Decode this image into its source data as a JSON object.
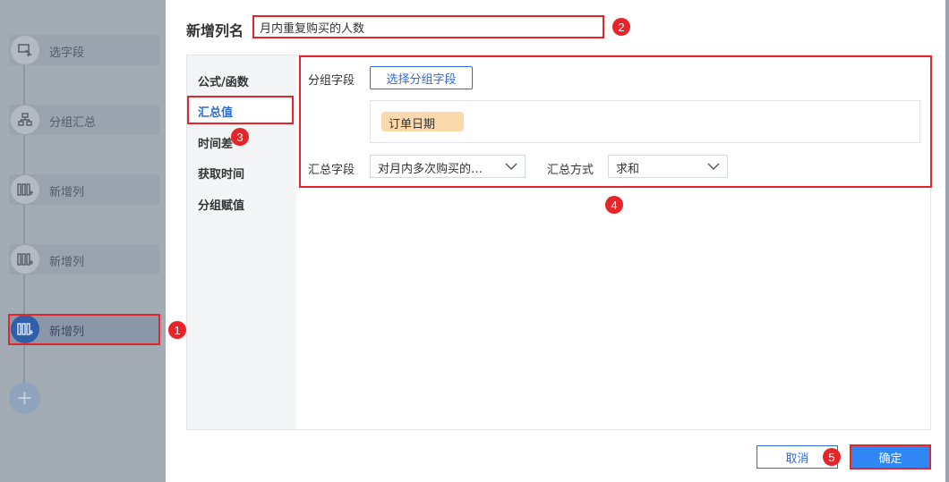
{
  "steps": [
    {
      "label": "选字段",
      "icon": "select-field-icon"
    },
    {
      "label": "分组汇总",
      "icon": "group-summary-icon"
    },
    {
      "label": "新增列",
      "icon": "add-column-icon"
    },
    {
      "label": "新增列",
      "icon": "add-column-icon"
    },
    {
      "label": "新增列",
      "icon": "add-column-icon"
    }
  ],
  "add_step_symbol": "+",
  "dialog": {
    "title": "新增列名",
    "name_value": "月内重复购买的人数"
  },
  "tabs": [
    {
      "label": "公式/函数"
    },
    {
      "label": "汇总值"
    },
    {
      "label": "时间差"
    },
    {
      "label": "获取时间"
    },
    {
      "label": "分组赋值"
    }
  ],
  "summary": {
    "group_field_label": "分组字段",
    "select_group_button": "选择分组字段",
    "group_tag": "订单日期",
    "summary_field_label": "汇总字段",
    "summary_field_value": "对月内多次购买的…",
    "summary_method_label": "汇总方式",
    "summary_method_value": "求和"
  },
  "footer": {
    "cancel_label": "取消",
    "ok_label": "确定"
  },
  "markers": [
    "1",
    "2",
    "3",
    "4",
    "5"
  ],
  "colors": {
    "accent": "#2f6bd6",
    "primary_button": "#2f86f5",
    "highlight": "#e5252a",
    "tag_bg": "#fbd9ac"
  }
}
